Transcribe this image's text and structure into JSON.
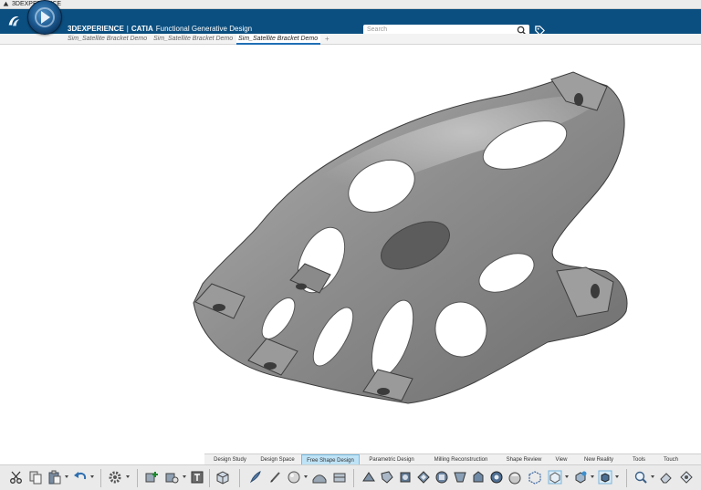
{
  "os_bar": {
    "title": "3DEXPERIENCE"
  },
  "header": {
    "brand": "3DEXPERIENCE",
    "separator": "|",
    "product": "CATIA",
    "app_name": "Functional Generative Design",
    "search_placeholder": "Search"
  },
  "doc_tabs": [
    {
      "label": "Sim_Satellite Bracket Demo"
    },
    {
      "label": "Sim_Satellite Bracket Demo"
    },
    {
      "label": "Sim_Satellite Bracket Demo"
    }
  ],
  "doc_tab_add": "+",
  "section_tabs": [
    {
      "label": "Design Study"
    },
    {
      "label": "Design Space"
    },
    {
      "label": "Free Shape Design"
    },
    {
      "label": "Parametric Design"
    },
    {
      "label": "Milling Reconstruction"
    },
    {
      "label": "Shape Review"
    },
    {
      "label": "View"
    },
    {
      "label": "New Reality"
    },
    {
      "label": "Tools"
    },
    {
      "label": "Touch"
    }
  ],
  "active_section": "Free Shape Design",
  "toolbar_icons": [
    "cut-icon",
    "copy-icon",
    "paste-icon",
    "undo-icon",
    "settings-icon",
    "add-part-icon",
    "part-options-icon",
    "properties-icon",
    "box-view-icon",
    "brush-icon",
    "pen-icon",
    "sphere-icon",
    "surface-icon",
    "shape-tool-1-icon",
    "shape-tool-2-icon",
    "shape-tool-3-icon",
    "shape-tool-4-icon",
    "shape-tool-5-icon",
    "shape-tool-6-icon",
    "shape-tool-7-icon",
    "shape-tool-8-icon",
    "shape-tool-9-icon",
    "shape-tool-10-icon",
    "cube-selection-icon",
    "cube-view-icon",
    "cube-display-icon",
    "zoom-icon",
    "eraser-icon",
    "navigate-icon"
  ],
  "colors": {
    "header_bg": "#0b4f80",
    "active_section_bg": "#bfe3f6",
    "model_gray": "#8f8f8f"
  }
}
